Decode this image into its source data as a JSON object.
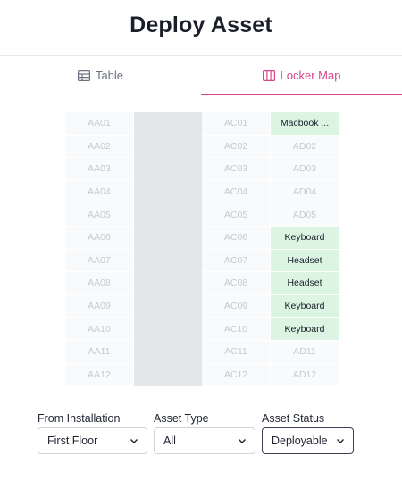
{
  "page": {
    "title": "Deploy Asset"
  },
  "tabs": [
    {
      "label": "Table",
      "icon": "table-icon",
      "active": false
    },
    {
      "label": "Locker Map",
      "icon": "columns-icon",
      "active": true
    }
  ],
  "colors": {
    "accent": "#d9468c",
    "occupied": "#dcf5e3",
    "empty": "#f9fafb",
    "aisle": "#e4e6ea"
  },
  "lockers": {
    "columns": [
      [
        "AA01",
        "AA02",
        "AA03",
        "AA04",
        "AA05",
        "AA06",
        "AA07",
        "AA08",
        "AA09",
        "AA10",
        "AA11",
        "AA12"
      ],
      [
        "AC01",
        "AC02",
        "AC03",
        "AC04",
        "AC05",
        "AC06",
        "AC07",
        "AC08",
        "AC09",
        "AC10",
        "AC11",
        "AC12"
      ],
      [
        "Macbook ...",
        "AD02",
        "AD03",
        "AD04",
        "AD05",
        "Keyboard",
        "Headset",
        "Headset",
        "Keyboard",
        "Keyboard",
        "AD11",
        "AD12"
      ]
    ],
    "occupied_last_column": [
      true,
      false,
      false,
      false,
      false,
      true,
      true,
      true,
      true,
      true,
      false,
      false
    ]
  },
  "filters": {
    "installation": {
      "label": "From Installation",
      "value": "First Floor"
    },
    "asset_type": {
      "label": "Asset Type",
      "value": "All"
    },
    "asset_status": {
      "label": "Asset Status",
      "value": "Deployable"
    }
  }
}
